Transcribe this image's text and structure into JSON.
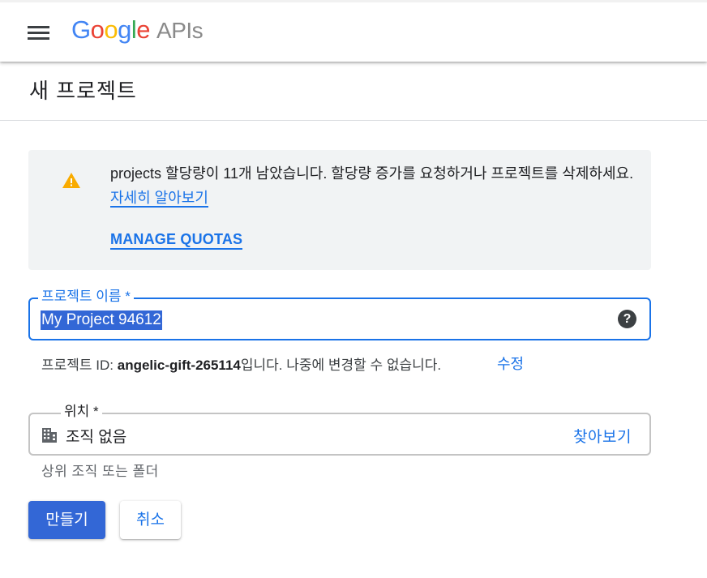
{
  "header": {
    "logo_letters": [
      "G",
      "o",
      "o",
      "g",
      "l",
      "e"
    ],
    "logo_suffix": "APIs",
    "menu_icon": "hamburger-menu-icon"
  },
  "page": {
    "title": "새 프로젝트"
  },
  "notice": {
    "icon": "warning-icon",
    "text": "projects 할당량이 11개 남았습니다. 할당량 증가를 요청하거나 프로젝트를 삭제하세요.",
    "learn_more": "자세히 알아보기",
    "manage_quotas": "MANAGE QUOTAS"
  },
  "project_name": {
    "label": "프로젝트 이름 *",
    "value": "My Project 94612",
    "help_icon": "?"
  },
  "project_id": {
    "prefix": "프로젝트 ID: ",
    "id": "angelic-gift-265114",
    "suffix": "입니다. 나중에 변경할 수 없습니다.",
    "edit": "수정"
  },
  "location": {
    "label": "위치 *",
    "icon": "building-icon",
    "value": "조직 없음",
    "browse": "찾아보기",
    "helper": "상위 조직 또는 폴더"
  },
  "actions": {
    "create": "만들기",
    "cancel": "취소"
  },
  "colors": {
    "accent": "#1a73e8",
    "primary_button": "#3367d6",
    "warning": "#f9ab00",
    "notice_bg": "#f1f3f4"
  }
}
